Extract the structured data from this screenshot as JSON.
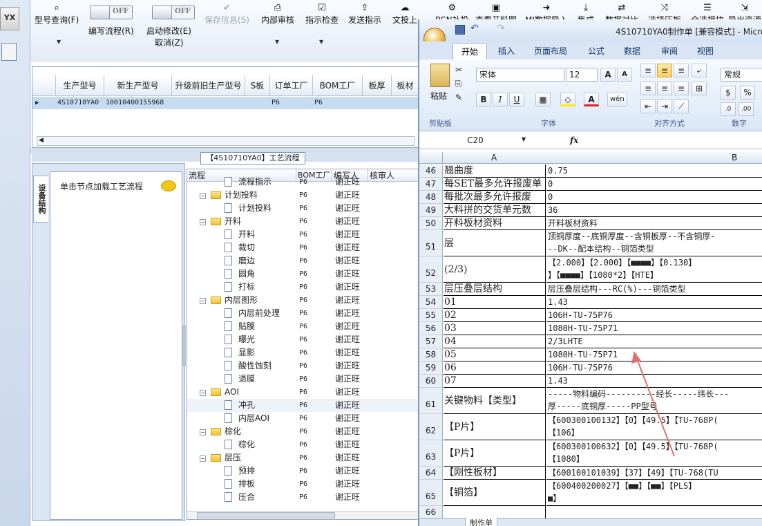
{
  "toolbar": {
    "items": [
      {
        "label": "型号查询(F)",
        "icon": "search-icon"
      },
      {
        "label": "编写流程(R)",
        "toggle": "OFF"
      },
      {
        "label": "启动修改(E)",
        "toggle": "OFF",
        "sub": "取消(Z)"
      },
      {
        "label": "保存信息(S)",
        "icon": "check-icon",
        "disabled": true
      },
      {
        "label": "内部审核",
        "icon": "print-icon"
      },
      {
        "label": "指示检查",
        "icon": "checkbox-icon"
      },
      {
        "label": "发送指示",
        "icon": "upload-icon"
      },
      {
        "label": "文投上",
        "icon": "cloud-upload-icon"
      },
      {
        "label": "PCN补投",
        "icon": "gear-icon"
      },
      {
        "label": "查看开料图",
        "icon": "image-icon"
      },
      {
        "label": "MI数据导入",
        "icon": "import-icon"
      },
      {
        "label": "集成",
        "icon": "download-icon"
      },
      {
        "label": "数据对比",
        "icon": "compare-icon"
      },
      {
        "label": "选择压板",
        "icon": "shuffle-icon"
      },
      {
        "label": "全选模块",
        "icon": "list-icon"
      },
      {
        "label": "导出资源",
        "icon": "export-icon"
      }
    ]
  },
  "top_grid": {
    "headers": [
      "生产型号",
      "新生产型号",
      "升级前旧生产型号",
      "S板",
      "订单工厂",
      "BOM工厂",
      "板厚",
      "板材"
    ],
    "rows": [
      [
        "4S10710YA0",
        "10010400155968",
        "",
        "",
        "P6",
        "P6",
        "",
        ""
      ]
    ]
  },
  "flow_title": "【4S10710YA0】工艺流程",
  "left_panel": {
    "vtab": "设备结构",
    "hint": "单击节点加载工艺流程"
  },
  "tree": {
    "headers": [
      "流程",
      "BOM工厂",
      "编写人",
      "核审人"
    ],
    "rows": [
      {
        "label": "流程指示",
        "level": 2,
        "bom": "P6",
        "writer": "谢正旺"
      },
      {
        "label": "计划投料",
        "level": 1,
        "bom": "P6",
        "writer": "谢正旺"
      },
      {
        "label": "计划投料",
        "level": 2,
        "bom": "P6",
        "writer": "谢正旺"
      },
      {
        "label": "开料",
        "level": 1,
        "bom": "P6",
        "writer": "谢正旺"
      },
      {
        "label": "开料",
        "level": 2,
        "bom": "P6",
        "writer": "谢正旺"
      },
      {
        "label": "裁切",
        "level": 2,
        "bom": "P6",
        "writer": "谢正旺"
      },
      {
        "label": "磨边",
        "level": 2,
        "bom": "P6",
        "writer": "谢正旺"
      },
      {
        "label": "圆角",
        "level": 2,
        "bom": "P6",
        "writer": "谢正旺"
      },
      {
        "label": "打标",
        "level": 2,
        "bom": "P6",
        "writer": "谢正旺"
      },
      {
        "label": "内层图形",
        "level": 1,
        "bom": "P6",
        "writer": "谢正旺"
      },
      {
        "label": "内层前处理",
        "level": 2,
        "bom": "P6",
        "writer": "谢正旺"
      },
      {
        "label": "贴膜",
        "level": 2,
        "bom": "P6",
        "writer": "谢正旺"
      },
      {
        "label": "曝光",
        "level": 2,
        "bom": "P6",
        "writer": "谢正旺"
      },
      {
        "label": "显影",
        "level": 2,
        "bom": "P6",
        "writer": "谢正旺"
      },
      {
        "label": "酸性蚀刻",
        "level": 2,
        "bom": "P6",
        "writer": "谢正旺"
      },
      {
        "label": "退膜",
        "level": 2,
        "bom": "P6",
        "writer": "谢正旺"
      },
      {
        "label": "AOI",
        "level": 1,
        "bom": "P6",
        "writer": "谢正旺"
      },
      {
        "label": "冲孔",
        "level": 2,
        "bom": "P6",
        "writer": "谢正旺",
        "highlight": true
      },
      {
        "label": "内层AOI",
        "level": 2,
        "bom": "P6",
        "writer": "谢正旺"
      },
      {
        "label": "棕化",
        "level": 1,
        "bom": "P6",
        "writer": "谢正旺"
      },
      {
        "label": "棕化",
        "level": 2,
        "bom": "P6",
        "writer": "谢正旺"
      },
      {
        "label": "层压",
        "level": 1,
        "bom": "P6",
        "writer": "谢正旺"
      },
      {
        "label": "预排",
        "level": 2,
        "bom": "P6",
        "writer": "谢正旺"
      },
      {
        "label": "排板",
        "level": 2,
        "bom": "P6",
        "writer": "谢正旺"
      },
      {
        "label": "压合",
        "level": 2,
        "bom": "P6",
        "writer": "谢正旺"
      }
    ]
  },
  "excel": {
    "title": "4S10710YA0制作单 [兼容模式] - Micro",
    "tabs": [
      "开始",
      "插入",
      "页面布局",
      "公式",
      "数据",
      "审阅",
      "视图"
    ],
    "font_name": "宋体",
    "font_size": "12",
    "number_format": "常规",
    "groups": [
      "剪贴板",
      "字体",
      "对齐方式",
      "数字"
    ],
    "paste_label": "粘贴",
    "name_box": "C20",
    "fx": "fx",
    "col_a": "A",
    "col_b": "B",
    "sheet_tab": "制作单",
    "rows": [
      {
        "n": "46",
        "a": "翘曲度",
        "b": [
          "0.75"
        ]
      },
      {
        "n": "47",
        "a": "每SET最多允许报废单",
        "b": [
          "0"
        ]
      },
      {
        "n": "48",
        "a": "每批次最多允许报废",
        "b": [
          "0"
        ]
      },
      {
        "n": "49",
        "a": "大料拼的交货单元数",
        "b": [
          "36"
        ]
      },
      {
        "n": "50",
        "a": "开料板材资料",
        "b": [
          "开料板材资料"
        ]
      },
      {
        "n": "51",
        "a": "层",
        "b": [
          "顶铜厚度--底铜厚度--含铜板厚--不含铜厚-",
          "--DK--配本结构--铜箔类型"
        ]
      },
      {
        "n": "52",
        "a": "(2/3)",
        "b": [
          "【2.000】【2.000】【■■■■】【0.130】",
          "】【■■■■】【1080*2】【HTE】"
        ]
      },
      {
        "n": "53",
        "a": "层压叠层结构",
        "b": [
          "层压叠层结构---RC(%)---铜箔类型"
        ]
      },
      {
        "n": "54",
        "a": "01",
        "b": [
          "1.43"
        ]
      },
      {
        "n": "55",
        "a": "02",
        "b": [
          "106H-TU-75P76"
        ]
      },
      {
        "n": "56",
        "a": "03",
        "b": [
          "1080H-TU-75P71"
        ]
      },
      {
        "n": "57",
        "a": "04",
        "b": [
          "2/3LHTE"
        ]
      },
      {
        "n": "58",
        "a": "05",
        "b": [
          "1080H-TU-75P71"
        ]
      },
      {
        "n": "59",
        "a": "06",
        "b": [
          "106H-TU-75P76"
        ]
      },
      {
        "n": "60",
        "a": "07",
        "b": [
          "1.43"
        ]
      },
      {
        "n": "61",
        "a": "关键物料【类型】",
        "b": [
          "-----物料编码----------经长-----纬长---",
          "厚-----底铜厚-----PP型号"
        ]
      },
      {
        "n": "62",
        "a": "【P片】",
        "b": [
          "【600300100132】【0】【49.5】【TU-768P(",
          "【106】"
        ]
      },
      {
        "n": "63",
        "a": "【P片】",
        "b": [
          "【600300100632】【0】【49.5】【TU-768P(",
          "【1080】"
        ]
      },
      {
        "n": "64",
        "a": "【刚性板材】",
        "b": [
          "【600100101039】【37】【49】【TU-768(TU"
        ]
      },
      {
        "n": "65",
        "a": "【铜箔】",
        "b": [
          "【600400200027】【■■】【■■】【PLS】",
          "■】"
        ]
      },
      {
        "n": "66",
        "a": "",
        "b": [
          ""
        ]
      }
    ]
  },
  "colors": {
    "accent": "#c6dcf2",
    "arrow": "#e07070",
    "ribbon": "#dbe7f6"
  }
}
